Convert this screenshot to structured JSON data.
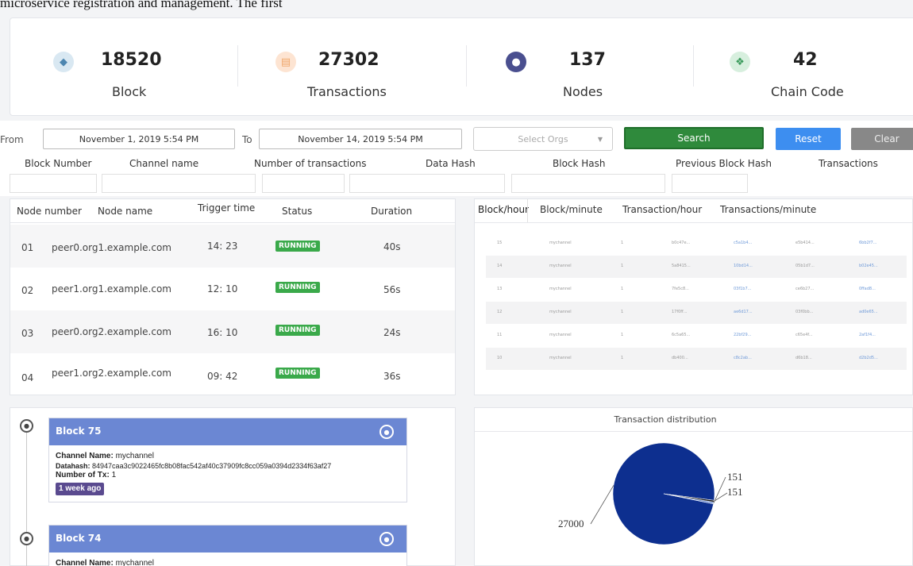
{
  "caption_top": "microservice registration and management. The first",
  "stats": [
    {
      "value": "18520",
      "label": "Block",
      "icon": "cube-icon",
      "color": "#4d86b0"
    },
    {
      "value": "27302",
      "label": "Transactions",
      "icon": "receipt-icon",
      "color": "#f0a76b"
    },
    {
      "value": "137",
      "label": "Nodes",
      "icon": "users-icon",
      "color": "#4a4f8f"
    },
    {
      "value": "42",
      "label": "Chain Code",
      "icon": "handshake-icon",
      "color": "#3c9b5d"
    }
  ],
  "filter": {
    "from_label": "From",
    "from_value": "November 1, 2019 5:54 PM",
    "to_label": "To",
    "to_value": "November 14, 2019 5:54 PM",
    "orgs_placeholder": "Select Orgs",
    "search_label": "Search",
    "reset_label": "Reset",
    "clear_label": "Clear"
  },
  "block_columns": [
    "Block Number",
    "Channel name",
    "Number of transactions",
    "Data Hash",
    "Block Hash",
    "Previous Block Hash",
    "Transactions"
  ],
  "nodes": {
    "headers": [
      "Node number",
      "Node name",
      "Trigger time",
      "Status",
      "Duration"
    ],
    "rows": [
      {
        "number": "01",
        "name": "peer0.org1.example.com",
        "time": "14: 23",
        "status": "RUNNING",
        "duration": "40s"
      },
      {
        "number": "02",
        "name": "peer1.org1.example.com",
        "time": "12: 10",
        "status": "RUNNING",
        "duration": "56s"
      },
      {
        "number": "03",
        "name": "peer0.org2.example.com",
        "time": "16: 10",
        "status": "RUNNING",
        "duration": "24s"
      },
      {
        "number": "04",
        "name": "peer1.org2.example.com",
        "time": "09: 42",
        "status": "RUNNING",
        "duration": "36s"
      }
    ]
  },
  "tabs": [
    "Block/hour",
    "Block/minute",
    "Transaction/hour",
    "Transactions/minute"
  ],
  "mini_rows": [
    [
      "15",
      "mychannel",
      "1",
      "b0c47e...",
      "c5a1b4...",
      "e5b414...",
      "6bb2f7..."
    ],
    [
      "14",
      "mychannel",
      "1",
      "5a8415...",
      "10bd14...",
      "05b1d7...",
      "b02e45..."
    ],
    [
      "13",
      "mychannel",
      "1",
      "7fe5c8...",
      "03f1b7...",
      "ce6b27...",
      "0ffad8..."
    ],
    [
      "12",
      "mychannel",
      "1",
      "17f0ff...",
      "ae6d17...",
      "03f0bb...",
      "ad0e65..."
    ],
    [
      "11",
      "mychannel",
      "1",
      "6c5a65...",
      "22bf29...",
      "c65e4f...",
      "2af1f4..."
    ],
    [
      "10",
      "mychannel",
      "1",
      "db400...",
      "c8c2ab...",
      "d6b18...",
      "d2b2d5..."
    ]
  ],
  "blocks": [
    {
      "title": "Block 75",
      "channel_label": "Channel Name:",
      "channel": "mychannel",
      "hash_label": "Datahash:",
      "hash": "84947caa3c9022465fc8b08fac542af40c37909fc8cc059a0394d2334f63af27",
      "tx_label": "Number of Tx:",
      "tx": "1",
      "ago": "1 week ago"
    },
    {
      "title": "Block 74",
      "channel_label": "Channel Name:",
      "channel": "mychannel"
    }
  ],
  "chart_data": {
    "type": "pie",
    "title": "Transaction distribution",
    "categories": [
      "27000",
      "151",
      "151"
    ],
    "values": [
      27000,
      151,
      151
    ],
    "colors": [
      "#0d2f8f",
      "#6f8fd6",
      "#111111"
    ],
    "data_labels": [
      "27000",
      "151",
      "151"
    ]
  }
}
